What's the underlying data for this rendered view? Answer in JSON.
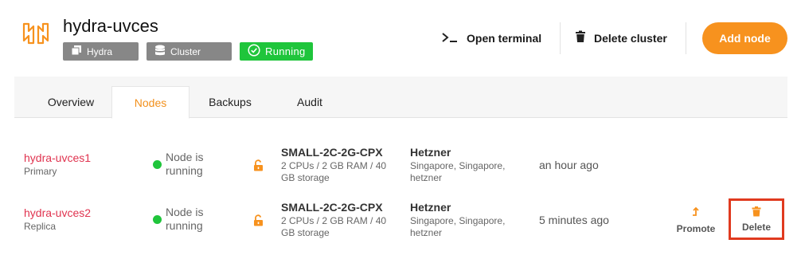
{
  "cluster": {
    "name": "hydra-uvces",
    "badges": {
      "engine": "Hydra",
      "type": "Cluster",
      "status": "Running"
    }
  },
  "actions": {
    "open_terminal": "Open terminal",
    "delete_cluster": "Delete cluster",
    "add_node": "Add node"
  },
  "tabs": {
    "overview": "Overview",
    "nodes": "Nodes",
    "backups": "Backups",
    "audit": "Audit",
    "active": "Nodes"
  },
  "nodes": [
    {
      "name": "hydra-uvces1",
      "role": "Primary",
      "status": "Node is running",
      "plan": "SMALL-2C-2G-CPX",
      "specs": "2 CPUs / 2 GB RAM / 40 GB storage",
      "provider": "Hetzner",
      "location": "Singapore, Singapore, hetzner",
      "created": "an hour ago"
    },
    {
      "name": "hydra-uvces2",
      "role": "Replica",
      "status": "Node is running",
      "plan": "SMALL-2C-2G-CPX",
      "specs": "2 CPUs / 2 GB RAM / 40 GB storage",
      "provider": "Hetzner",
      "location": "Singapore, Singapore, hetzner",
      "created": "5 minutes ago",
      "promote_label": "Promote",
      "delete_label": "Delete"
    }
  ],
  "colors": {
    "accent": "#f7921e",
    "running": "#1fc53b",
    "node_link": "#e0334f",
    "highlight_border": "#e03a1f",
    "badge_grey": "#878787"
  },
  "icons": {
    "logo": "hydra-logo-icon",
    "hydra_badge": "copy-icon",
    "cluster_badge": "database-icon",
    "running_badge": "check-circle-icon",
    "terminal": "terminal-icon",
    "delete_cluster": "trash-icon",
    "lock": "unlocked-lock-icon",
    "promote": "arrow-up-icon",
    "delete_node": "trash-icon"
  }
}
